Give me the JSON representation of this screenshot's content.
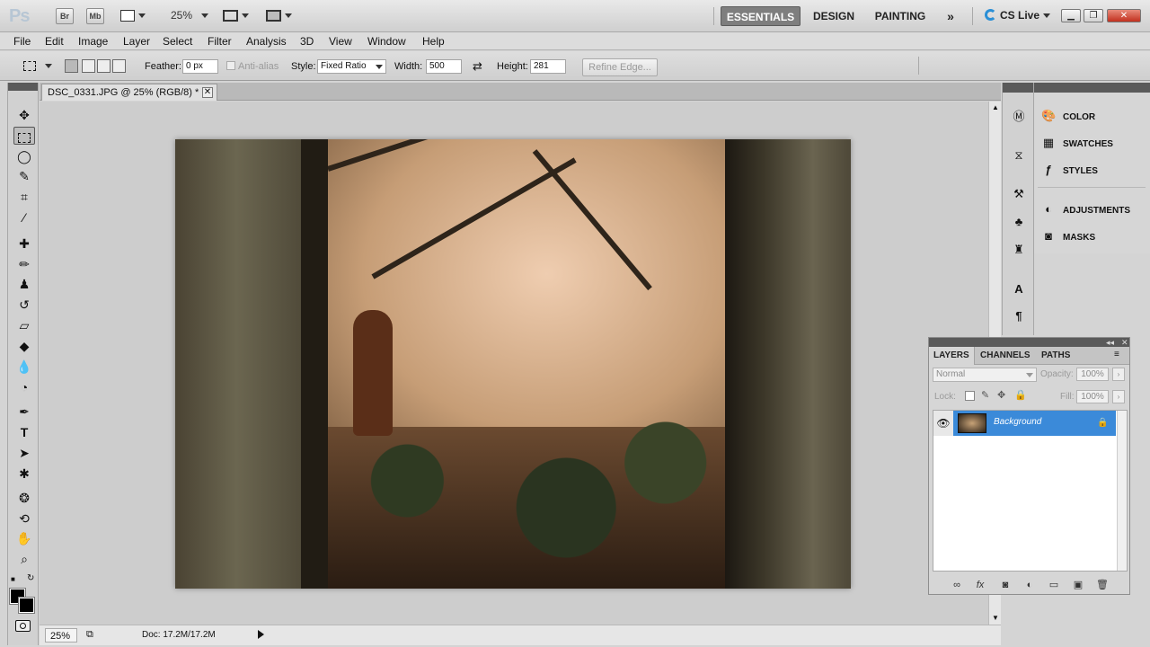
{
  "app": {
    "logo": "Ps",
    "bridge_label": "Br",
    "minibridge_label": "Mb",
    "zoom_value": "25%",
    "workspaces": [
      "ESSENTIALS",
      "DESIGN",
      "PAINTING"
    ],
    "more_workspaces": "»",
    "cs_live": "CS Live"
  },
  "menu": [
    "File",
    "Edit",
    "Image",
    "Layer",
    "Select",
    "Filter",
    "Analysis",
    "3D",
    "View",
    "Window",
    "Help"
  ],
  "options": {
    "feather_label": "Feather:",
    "feather_value": "0 px",
    "antialias_label": "Anti-alias",
    "style_label": "Style:",
    "style_value": "Fixed Ratio",
    "width_label": "Width:",
    "width_value": "500",
    "height_label": "Height:",
    "height_value": "281",
    "refine_edge": "Refine Edge..."
  },
  "document": {
    "tab_title": "DSC_0331.JPG @ 25% (RGB/8) *",
    "status_zoom": "25%",
    "status_doc": "Doc: 17.2M/17.2M"
  },
  "dock": {
    "panels": [
      "COLOR",
      "SWATCHES",
      "STYLES",
      "ADJUSTMENTS",
      "MASKS"
    ]
  },
  "layers": {
    "tabs": [
      "LAYERS",
      "CHANNELS",
      "PATHS"
    ],
    "blend_mode": "Normal",
    "opacity_label": "Opacity:",
    "opacity_value": "100%",
    "lock_label": "Lock:",
    "fill_label": "Fill:",
    "fill_value": "100%",
    "layer_name": "Background"
  },
  "colors": {
    "selection_blue": "#3b8ad9",
    "active_workspace": "#7e7e7e"
  }
}
